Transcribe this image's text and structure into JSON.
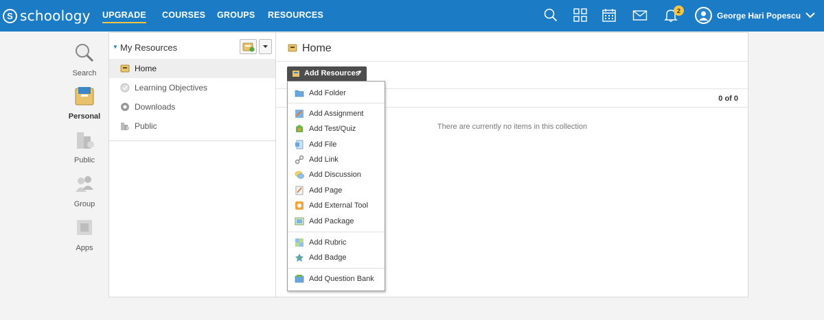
{
  "app": {
    "logo_text": "schoology",
    "logo_letter": "S"
  },
  "nav": [
    {
      "label": "UPGRADE",
      "active": true
    },
    {
      "label": "COURSES",
      "active": false
    },
    {
      "label": "GROUPS",
      "active": false
    },
    {
      "label": "RESOURCES",
      "active": false
    }
  ],
  "header_icons": [
    "search-icon",
    "apps-grid-icon",
    "calendar-icon",
    "mail-icon",
    "bell-icon"
  ],
  "notifications": {
    "count": "2"
  },
  "user": {
    "name": "George Hari Popescu"
  },
  "rail": [
    {
      "label": "Search",
      "icon": "search-icon"
    },
    {
      "label": "Personal",
      "icon": "personal-icon",
      "active": true
    },
    {
      "label": "Public",
      "icon": "public-icon"
    },
    {
      "label": "Group",
      "icon": "group-icon"
    },
    {
      "label": "Apps",
      "icon": "apps-icon"
    }
  ],
  "tree": {
    "title": "My Resources",
    "items": [
      {
        "label": "Home",
        "icon": "home-collection-icon",
        "selected": true
      },
      {
        "label": "Learning Objectives",
        "icon": "objectives-icon"
      },
      {
        "label": "Downloads",
        "icon": "downloads-icon"
      },
      {
        "label": "Public",
        "icon": "public-icon"
      }
    ]
  },
  "main": {
    "title": "Home",
    "count": "0 of 0",
    "empty_message": "There are currently no items in this collection"
  },
  "add_resources": {
    "label": "Add Resources",
    "items": [
      {
        "label": "Add Folder",
        "icon": "folder-icon"
      },
      {
        "label": "Add Assignment",
        "icon": "assignment-icon"
      },
      {
        "label": "Add Test/Quiz",
        "icon": "quiz-icon"
      },
      {
        "label": "Add File",
        "icon": "file-icon"
      },
      {
        "label": "Add Link",
        "icon": "link-icon"
      },
      {
        "label": "Add Discussion",
        "icon": "discussion-icon"
      },
      {
        "label": "Add Page",
        "icon": "page-icon"
      },
      {
        "label": "Add External Tool",
        "icon": "external-tool-icon"
      },
      {
        "label": "Add Package",
        "icon": "package-icon"
      },
      {
        "label": "Add Rubric",
        "icon": "rubric-icon"
      },
      {
        "label": "Add Badge",
        "icon": "badge-icon"
      },
      {
        "label": "Add Question Bank",
        "icon": "question-bank-icon"
      }
    ]
  },
  "colors": {
    "header": "#1b7bc4",
    "accent": "#f6c445",
    "button_dark": "#4d4d4d"
  }
}
